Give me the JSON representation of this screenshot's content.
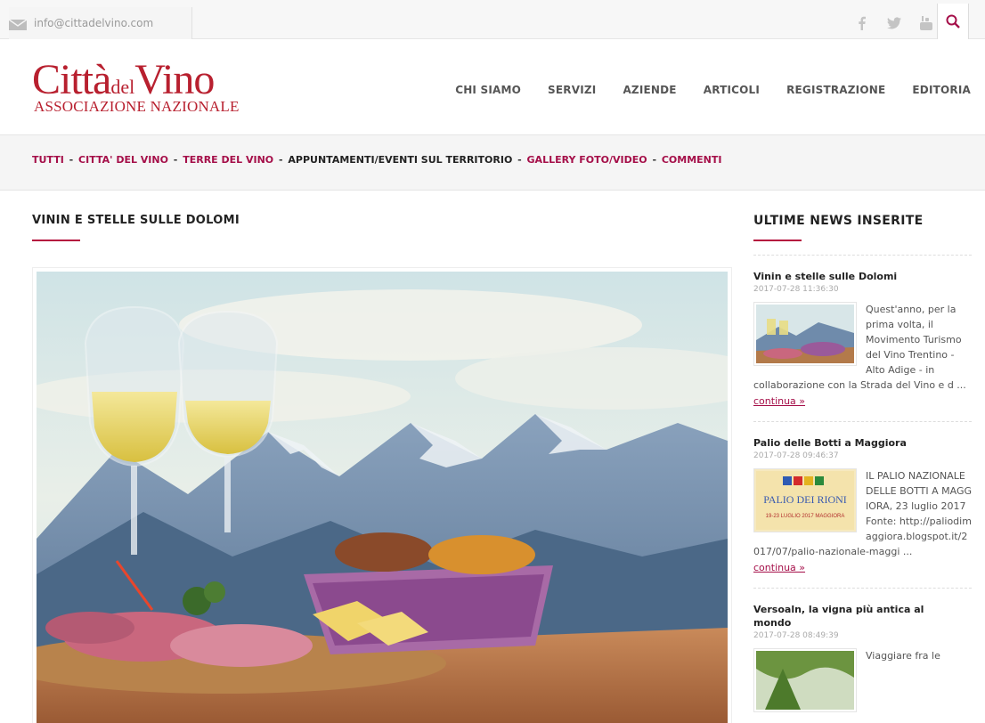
{
  "topbar": {
    "email": "info@cittadelvino.com",
    "social": [
      "facebook-icon",
      "twitter-icon",
      "youtube-icon"
    ],
    "search_icon": "search-icon",
    "accent": "#a50f49"
  },
  "logo": {
    "city": "Città",
    "del": "del",
    "vino": "Vino",
    "subtitle": "ASSOCIAZIONE NAZIONALE",
    "color": "#b8202f"
  },
  "nav": [
    "CHI SIAMO",
    "SERVIZI",
    "AZIENDE",
    "ARTICOLI",
    "REGISTRAZIONE",
    "EDITORIA"
  ],
  "categories": [
    {
      "label": "TUTTI",
      "active": false
    },
    {
      "label": "CITTA' DEL VINO",
      "active": false
    },
    {
      "label": "TERRE DEL VINO",
      "active": false
    },
    {
      "label": "APPUNTAMENTI/EVENTI SUL TERRITORIO",
      "active": true
    },
    {
      "label": "GALLERY FOTO/VIDEO",
      "active": false
    },
    {
      "label": "COMMENTI",
      "active": false
    }
  ],
  "article": {
    "title": "VININ E STELLE SULLE DOLOMI"
  },
  "sidebar": {
    "title": "ULTIME NEWS INSERITE",
    "items": [
      {
        "title": "Vinin e stelle sulle Dolomi",
        "date": "2017-07-28 11:36:30",
        "excerpt": "Quest'anno, per la prima volta, il Movimento Turismo del Vino Trentino - Alto Adige - in collaborazione con la Strada del Vino e d ...",
        "more": "continua »"
      },
      {
        "title": "Palio delle Botti a Maggiora",
        "date": "2017-07-28 09:46:37",
        "excerpt": "IL PALIO NAZIONALE DELLE BOTTI A MAGGIORA, 23 luglio 2017 Fonte: http://paliodimaggiora.blogspot.it/2017/07/palio-nazionale-maggi ...",
        "more": "continua »",
        "thumb_text": [
          "PALIO DEI RIONI",
          "19-23 LUGLIO 2017  MAGGIORA"
        ]
      },
      {
        "title": "Versoaln, la vigna più antica al mondo",
        "date": "2017-07-28 08:49:39",
        "excerpt": "Viaggiare fra le",
        "more": ""
      }
    ]
  }
}
